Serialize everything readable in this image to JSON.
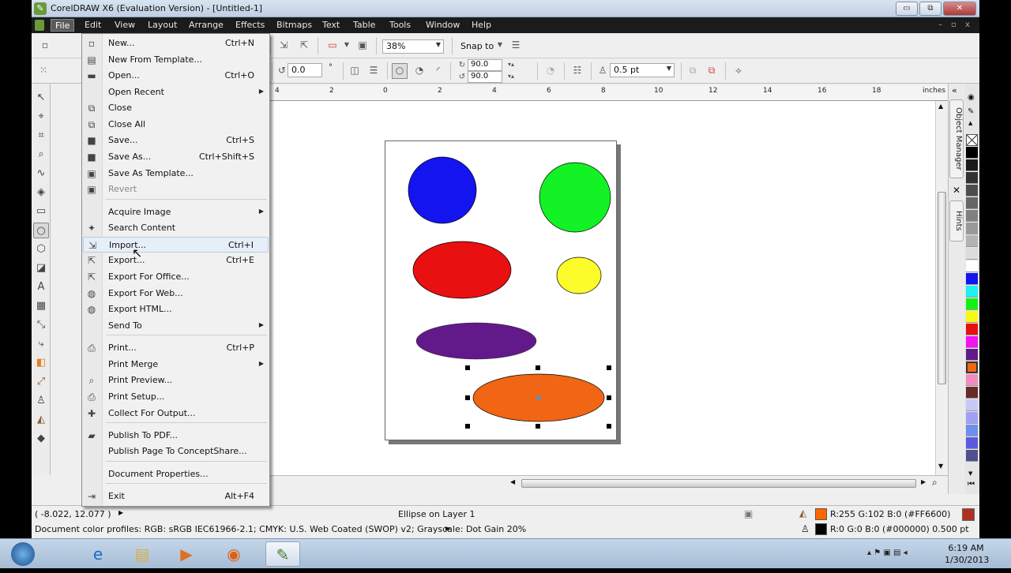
{
  "window": {
    "title": "CorelDRAW X6 (Evaluation Version) - [Untitled-1]",
    "controls": {
      "minimize": "▭",
      "restore": "⧉",
      "close": "✕"
    },
    "mdi_controls": {
      "minimize": "–",
      "restore": "▫",
      "close": "x"
    }
  },
  "menubar": {
    "items": [
      {
        "label": "File",
        "active": true
      },
      {
        "label": "Edit"
      },
      {
        "label": "View"
      },
      {
        "label": "Layout"
      },
      {
        "label": "Arrange"
      },
      {
        "label": "Effects"
      },
      {
        "label": "Bitmaps"
      },
      {
        "label": "Text"
      },
      {
        "label": "Table"
      },
      {
        "label": "Tools"
      },
      {
        "label": "Window"
      },
      {
        "label": "Help"
      }
    ]
  },
  "standard_toolbar": {
    "zoom_level": "38%",
    "snap_to": "Snap to"
  },
  "property_bar": {
    "percent_top": "%",
    "percent_bottom": "%",
    "rotation": "0.0",
    "degree": "°",
    "start_angle": "90.0",
    "end_angle": "90.0",
    "outline_width": "0.5 pt"
  },
  "ruler": {
    "unit": "inches",
    "ticks": [
      "4",
      "2",
      "0",
      "2",
      "4",
      "6",
      "8",
      "10",
      "12",
      "14",
      "16",
      "18"
    ]
  },
  "file_menu": {
    "items": [
      {
        "label": "New...",
        "shortcut": "Ctrl+N",
        "icon": "new-document-icon",
        "glyph": "▫"
      },
      {
        "label": "New From Template...",
        "shortcut": "",
        "icon": "new-from-template-icon",
        "glyph": "▤"
      },
      {
        "label": "Open...",
        "shortcut": "Ctrl+O",
        "icon": "folder-open-icon",
        "glyph": "▬"
      },
      {
        "label": "Open Recent",
        "shortcut": "",
        "submenu": true,
        "icon": "",
        "glyph": ""
      },
      {
        "label": "Close",
        "shortcut": "",
        "icon": "close-document-icon",
        "glyph": "⧉"
      },
      {
        "label": "Close All",
        "shortcut": "",
        "icon": "close-all-icon",
        "glyph": "⧉"
      },
      {
        "label": "Save...",
        "shortcut": "Ctrl+S",
        "icon": "save-icon",
        "glyph": "■"
      },
      {
        "label": "Save As...",
        "shortcut": "Ctrl+Shift+S",
        "icon": "save-as-icon",
        "glyph": "■"
      },
      {
        "label": "Save As Template...",
        "shortcut": "",
        "icon": "save-template-icon",
        "glyph": "▣"
      },
      {
        "label": "Revert",
        "shortcut": "",
        "disabled": true,
        "icon": "revert-icon",
        "glyph": "▣"
      },
      {
        "label": "Acquire Image",
        "shortcut": "",
        "submenu": true,
        "icon": "",
        "glyph": ""
      },
      {
        "label": "Search Content",
        "shortcut": "",
        "icon": "search-content-icon",
        "glyph": "✦"
      },
      {
        "label": "Import...",
        "shortcut": "Ctrl+I",
        "hover": true,
        "icon": "import-icon",
        "glyph": "⇲"
      },
      {
        "label": "Export...",
        "shortcut": "Ctrl+E",
        "icon": "export-icon",
        "glyph": "⇱"
      },
      {
        "label": "Export For Office...",
        "shortcut": "",
        "icon": "export-office-icon",
        "glyph": "⇱"
      },
      {
        "label": "Export For Web...",
        "shortcut": "",
        "icon": "export-web-icon",
        "glyph": "◍"
      },
      {
        "label": "Export HTML...",
        "shortcut": "",
        "icon": "export-html-icon",
        "glyph": "◍"
      },
      {
        "label": "Send To",
        "shortcut": "",
        "submenu": true,
        "icon": "",
        "glyph": ""
      },
      {
        "label": "Print...",
        "shortcut": "Ctrl+P",
        "icon": "print-icon",
        "glyph": "⎙"
      },
      {
        "label": "Print Merge",
        "shortcut": "",
        "submenu": true,
        "icon": "",
        "glyph": ""
      },
      {
        "label": "Print Preview...",
        "shortcut": "",
        "icon": "print-preview-icon",
        "glyph": "⌕"
      },
      {
        "label": "Print Setup...",
        "shortcut": "",
        "icon": "print-setup-icon",
        "glyph": "⎙"
      },
      {
        "label": "Collect For Output...",
        "shortcut": "",
        "icon": "collect-output-icon",
        "glyph": "✚"
      },
      {
        "label": "Publish To PDF...",
        "shortcut": "",
        "icon": "pdf-icon",
        "glyph": "▰"
      },
      {
        "label": "Publish Page To ConceptShare...",
        "shortcut": "",
        "icon": "",
        "glyph": ""
      },
      {
        "label": "Document Properties...",
        "shortcut": "",
        "icon": "",
        "glyph": ""
      },
      {
        "label": "Exit",
        "shortcut": "Alt+F4",
        "icon": "exit-icon",
        "glyph": "⇥"
      }
    ]
  },
  "canvas": {
    "shapes": [
      {
        "name": "blue-circle",
        "fill": "#1414f0"
      },
      {
        "name": "green-circle",
        "fill": "#12f224"
      },
      {
        "name": "red-ellipse",
        "fill": "#e81010"
      },
      {
        "name": "yellow-ellipse",
        "fill": "#fcfc2a"
      },
      {
        "name": "purple-ellipse",
        "fill": "#621a8a"
      },
      {
        "name": "orange-ellipse",
        "fill": "#f06614",
        "selected": true
      }
    ]
  },
  "dockers": {
    "object_manager": "Object Manager",
    "hints": "Hints"
  },
  "palette": {
    "colors": [
      "none",
      "#000000",
      "#1a1a1a",
      "#333333",
      "#4d4d4d",
      "#666666",
      "#808080",
      "#999999",
      "#b3b3b3",
      "#dcdcdc",
      "#ffffff",
      "#1414f0",
      "#1ef0f0",
      "#14f014",
      "#f8f814",
      "#e81010",
      "#f014f0",
      "#621a8a",
      "#f06614",
      "#f08cc0",
      "#6a2a2a",
      "#c8c8f8",
      "#a0a0f8",
      "#6e8ef0",
      "#5a5ae0",
      "#505090"
    ],
    "selected_index": 18
  },
  "status": {
    "coordinates": "( -8.022, 12.077 )",
    "object_info": "Ellipse on Layer 1",
    "color_profiles": "Document color profiles: RGB: sRGB IEC61966-2.1; CMYK: U.S. Web Coated (SWOP) v2; Grayscale: Dot Gain 20%",
    "fill_color": "#FF6600",
    "fill_text": "R:255 G:102 B:0 (#FF6600)",
    "outline_color": "#000000",
    "outline_text": "R:0 G:0 B:0 (#000000)  0.500 pt"
  },
  "taskbar": {
    "time": "6:19 AM",
    "date": "1/30/2013"
  }
}
